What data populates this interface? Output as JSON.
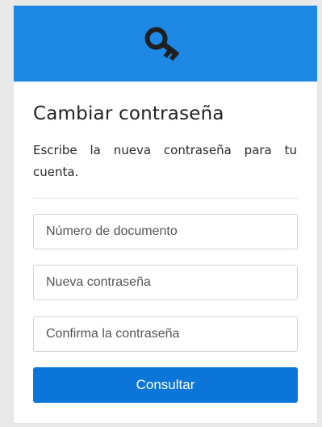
{
  "header": {
    "icon": "key-icon",
    "color": "#1e88e5"
  },
  "form": {
    "title": "Cambiar contraseña",
    "subtitle": "Escribe la nueva contraseña para tu cuenta.",
    "document_placeholder": "Número de documento",
    "new_password_placeholder": "Nueva contraseña",
    "confirm_password_placeholder": "Confirma la contraseña",
    "submit_label": "Consultar"
  },
  "colors": {
    "button": "#0b76d8",
    "background": "#e9e9e9"
  }
}
